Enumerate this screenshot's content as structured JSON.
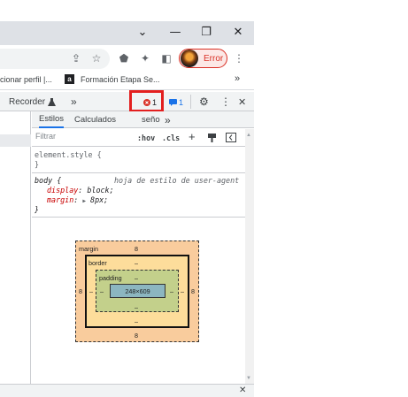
{
  "window": {
    "chevron_glyph": "⌄",
    "minimize_glyph": "—",
    "restore_glyph": "❐",
    "close_glyph": "✕"
  },
  "toolbar": {
    "share_glyph": "⇪",
    "star_glyph": "☆",
    "ext1_glyph": "⬟",
    "puzzle_glyph": "✦",
    "sidepanel_glyph": "◧",
    "menu_glyph": "⋮",
    "profile_error_label": "Error",
    "error_color": "#d93025"
  },
  "bookmarks": {
    "item1_label": "cionar perfil |...",
    "item2_label": "Formación Etapa Se...",
    "item2_icon_letter": "a",
    "more_glyph": "»"
  },
  "devtools": {
    "tab_recorder": "Recorder",
    "more_tabs_glyph": "»",
    "error_count": "1",
    "message_count": "1",
    "settings_glyph": "⚙",
    "kebab_glyph": "⋮",
    "close_glyph": "✕",
    "highlight_color": "#e31f1f"
  },
  "styles_pane": {
    "tabs": [
      "Estilos",
      "Calculados",
      "seño"
    ],
    "more_glyph": "»",
    "filter_placeholder": "Filtrar",
    "hov": ":hov",
    "cls": ".cls",
    "plus": "+",
    "element_style_open": "element.style {",
    "element_style_close": "}",
    "body_selector": "body {",
    "source_label": "hoja de estilo de user-agent",
    "prop1_name": "display",
    "prop1_value": "block;",
    "prop2_name": "margin",
    "prop2_value": "8px;",
    "rule_close": "}"
  },
  "box_model": {
    "margin_label": "margin",
    "margin_top": "8",
    "margin_right": "8",
    "margin_bottom": "8",
    "margin_left": "8",
    "border_label": "border",
    "border_top": "–",
    "border_right": "–",
    "border_bottom": "–",
    "border_left": "–",
    "padding_label": "padding",
    "padding_top": "–",
    "padding_right": "–",
    "padding_bottom": "–",
    "padding_left": "–",
    "content_size": "248×609",
    "colors": {
      "margin": "#f9cc9d",
      "border": "#fddd9b",
      "padding": "#c3d08b",
      "content": "#8cb6c0"
    }
  },
  "drawer": {
    "close_glyph": "✕"
  }
}
